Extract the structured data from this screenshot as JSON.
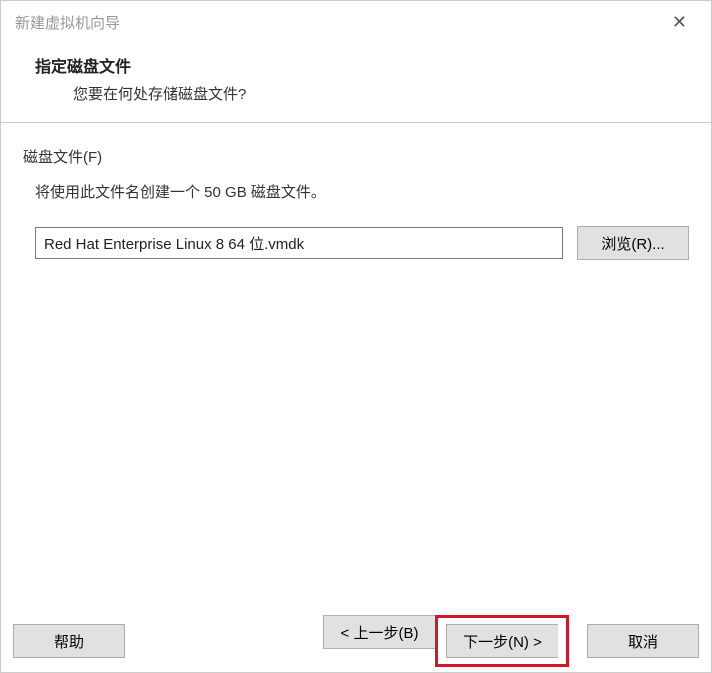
{
  "window": {
    "title": "新建虚拟机向导"
  },
  "header": {
    "title": "指定磁盘文件",
    "subtitle": "您要在何处存储磁盘文件?"
  },
  "group": {
    "label": "磁盘文件(F)",
    "description": "将使用此文件名创建一个 50 GB 磁盘文件。"
  },
  "file": {
    "value": "Red Hat Enterprise Linux 8 64 位.vmdk",
    "browse": "浏览(R)..."
  },
  "footer": {
    "help": "帮助",
    "back": "< 上一步(B)",
    "next": "下一步(N) >",
    "cancel": "取消"
  }
}
